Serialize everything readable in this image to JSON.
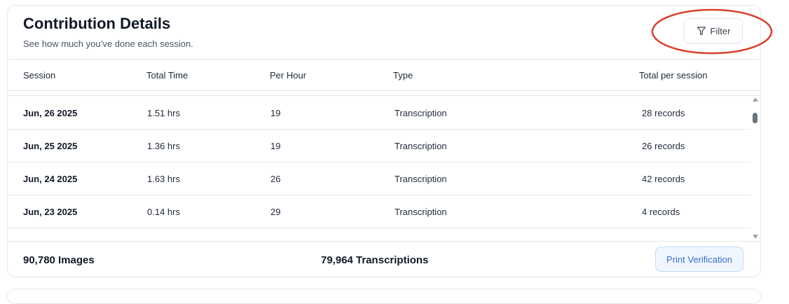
{
  "card": {
    "title": "Contribution Details",
    "subtitle": "See how much you’ve done each session.",
    "filter_label": "Filter",
    "filter_icon": "funnel-icon"
  },
  "table": {
    "headers": {
      "session": "Session",
      "total_time": "Total Time",
      "per_hour": "Per Hour",
      "type": "Type",
      "total_per_session": "Total per session"
    },
    "rows": [
      {
        "session": "Jun, 26 2025",
        "total_time": "1.51 hrs",
        "per_hour": "19",
        "type": "Transcription",
        "total": "28 records"
      },
      {
        "session": "Jun, 25 2025",
        "total_time": "1.36 hrs",
        "per_hour": "19",
        "type": "Transcription",
        "total": "26 records"
      },
      {
        "session": "Jun, 24 2025",
        "total_time": "1.63 hrs",
        "per_hour": "26",
        "type": "Transcription",
        "total": "42 records"
      },
      {
        "session": "Jun, 23 2025",
        "total_time": "0.14 hrs",
        "per_hour": "29",
        "type": "Transcription",
        "total": "4 records"
      }
    ]
  },
  "footer": {
    "images": "90,780 Images",
    "transcriptions": "79,964 Transcriptions",
    "print_label": "Print Verification"
  },
  "colors": {
    "annotation": "#d9402b",
    "print_button_text": "#3b6fc4",
    "print_button_bg": "#eff6ff"
  }
}
